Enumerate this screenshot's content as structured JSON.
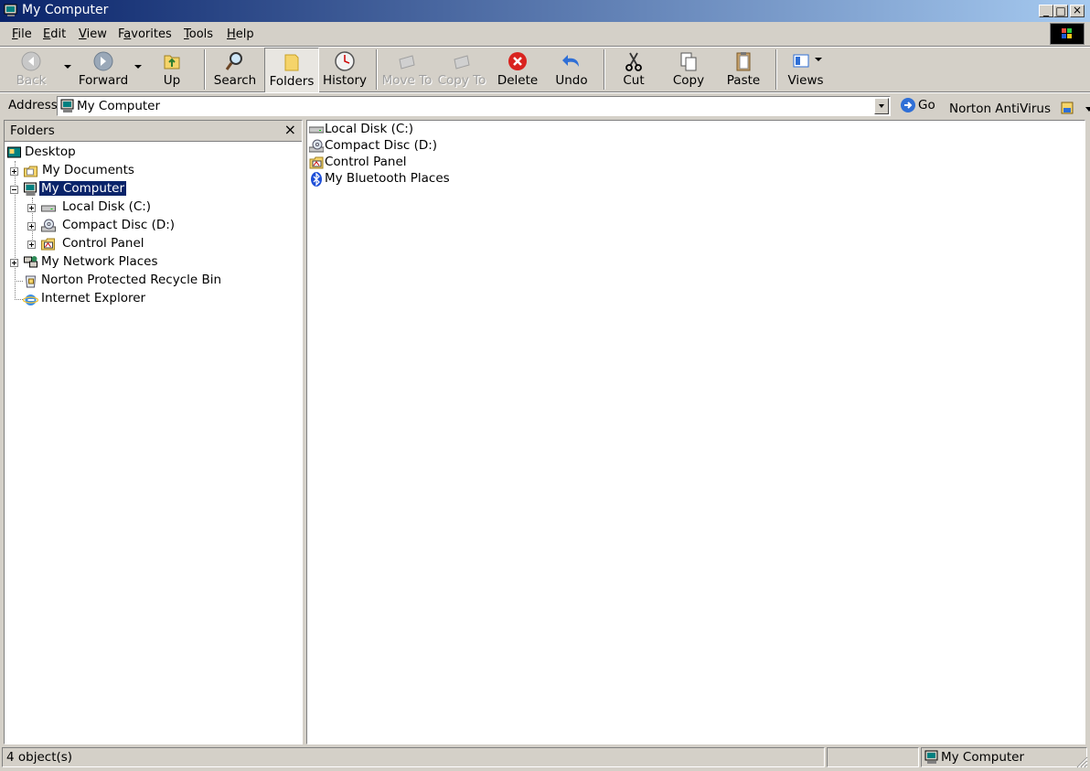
{
  "window": {
    "title": "My Computer"
  },
  "menu": [
    "File",
    "Edit",
    "View",
    "Favorites",
    "Tools",
    "Help"
  ],
  "menu_access_keys": [
    "F",
    "E",
    "V",
    "a",
    "T",
    "H"
  ],
  "toolbar": {
    "back": "Back",
    "forward": "Forward",
    "up": "Up",
    "search": "Search",
    "folders": "Folders",
    "history": "History",
    "move_to": "Move To",
    "copy_to": "Copy To",
    "delete": "Delete",
    "undo": "Undo",
    "cut": "Cut",
    "copy": "Copy",
    "paste": "Paste",
    "views": "Views"
  },
  "address": {
    "label": "Address",
    "value": "My Computer",
    "go": "Go",
    "norton": "Norton AntiVirus"
  },
  "folders_pane": {
    "title": "Folders",
    "close": "×",
    "tree": [
      {
        "label": "Desktop"
      },
      {
        "label": "My Documents"
      },
      {
        "label": "My Computer",
        "selected": true
      },
      {
        "label": "Local Disk (C:)"
      },
      {
        "label": "Compact Disc (D:)"
      },
      {
        "label": "Control Panel"
      },
      {
        "label": "My Network Places"
      },
      {
        "label": "Norton Protected Recycle Bin"
      },
      {
        "label": "Internet Explorer"
      }
    ]
  },
  "content": {
    "items": [
      {
        "label": "Local Disk (C:)",
        "icon": "hard-drive-icon"
      },
      {
        "label": "Compact Disc (D:)",
        "icon": "cd-drive-icon"
      },
      {
        "label": "Control Panel",
        "icon": "control-panel-icon"
      },
      {
        "label": "My Bluetooth Places",
        "icon": "bluetooth-icon"
      }
    ]
  },
  "status": {
    "count": "4 object(s)",
    "location": "My Computer"
  },
  "colors": {
    "titlebar_start": "#0a246a",
    "titlebar_end": "#a6caf0",
    "face": "#d4d0c8",
    "selection": "#0a246a"
  }
}
